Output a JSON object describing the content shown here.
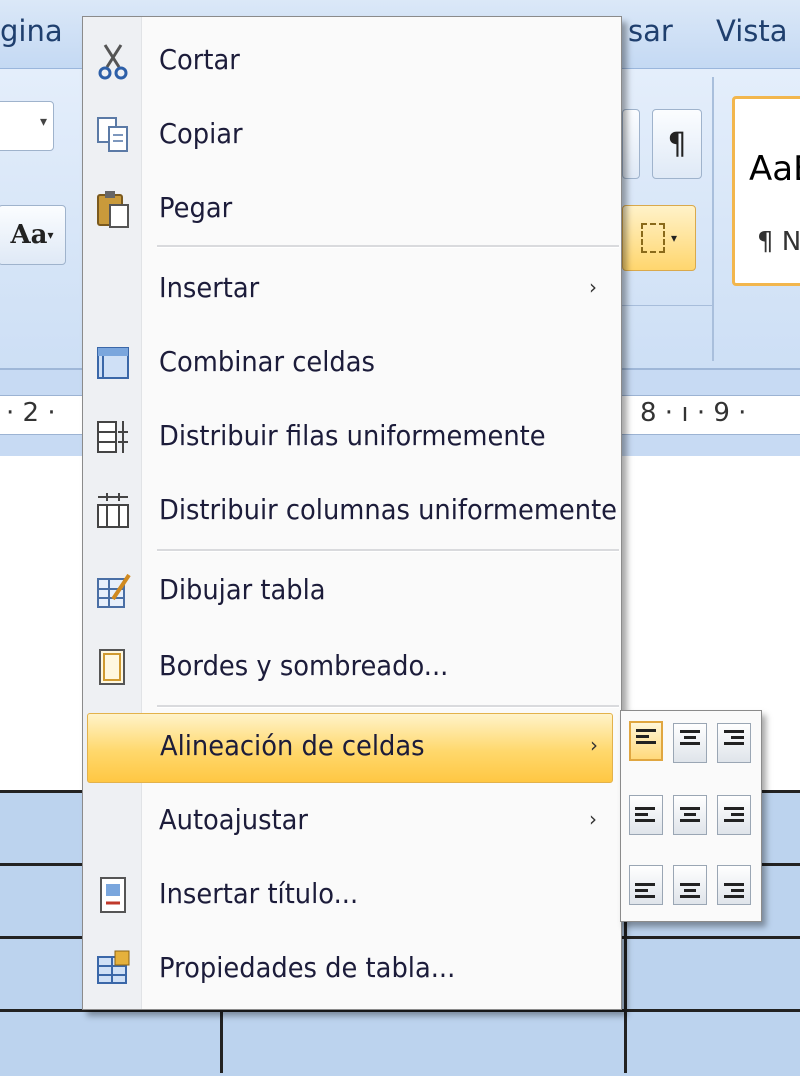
{
  "tabs": {
    "left": "gina",
    "middle": "sar",
    "right": "Vista"
  },
  "ribbon": {
    "font_size_button": "Aa",
    "pilcrow": "¶",
    "style_preview": "AaB",
    "style_name": "¶ N",
    "launcher": "↘"
  },
  "ruler": {
    "left": "· 2 ·",
    "right": "8 · ı · 9 ·"
  },
  "context_menu": {
    "items": [
      {
        "label": "Cortar",
        "icon": "scissors-icon"
      },
      {
        "label": "Copiar",
        "icon": "copy-icon"
      },
      {
        "label": "Pegar",
        "icon": "paste-icon"
      },
      {
        "label": "Insertar",
        "has_submenu": true
      },
      {
        "label": "Combinar celdas",
        "icon": "merge-cells-icon"
      },
      {
        "label": "Distribuir filas uniformemente",
        "icon": "distribute-rows-icon"
      },
      {
        "label": "Distribuir columnas uniformemente",
        "icon": "distribute-columns-icon"
      },
      {
        "label": "Dibujar tabla",
        "icon": "draw-table-icon"
      },
      {
        "label": "Bordes y sombreado...",
        "icon": "borders-shading-icon"
      },
      {
        "label": "Alineación de celdas",
        "has_submenu": true,
        "highlighted": true
      },
      {
        "label": "Autoajustar",
        "has_submenu": true
      },
      {
        "label": "Insertar título...",
        "icon": "insert-caption-icon"
      },
      {
        "label": "Propiedades de tabla...",
        "icon": "table-properties-icon"
      }
    ],
    "submenu_arrow": "›"
  },
  "align_submenu": {
    "options": [
      [
        "top-left",
        "top-center",
        "top-right"
      ],
      [
        "middle-left",
        "middle-center",
        "middle-right"
      ],
      [
        "bottom-left",
        "bottom-center",
        "bottom-right"
      ]
    ],
    "selected": "top-left"
  },
  "colors": {
    "highlight": "#ffd86c",
    "ribbon": "#cddff5",
    "table_fill": "#bcd3ee",
    "menu_text": "#1c1c3a"
  }
}
